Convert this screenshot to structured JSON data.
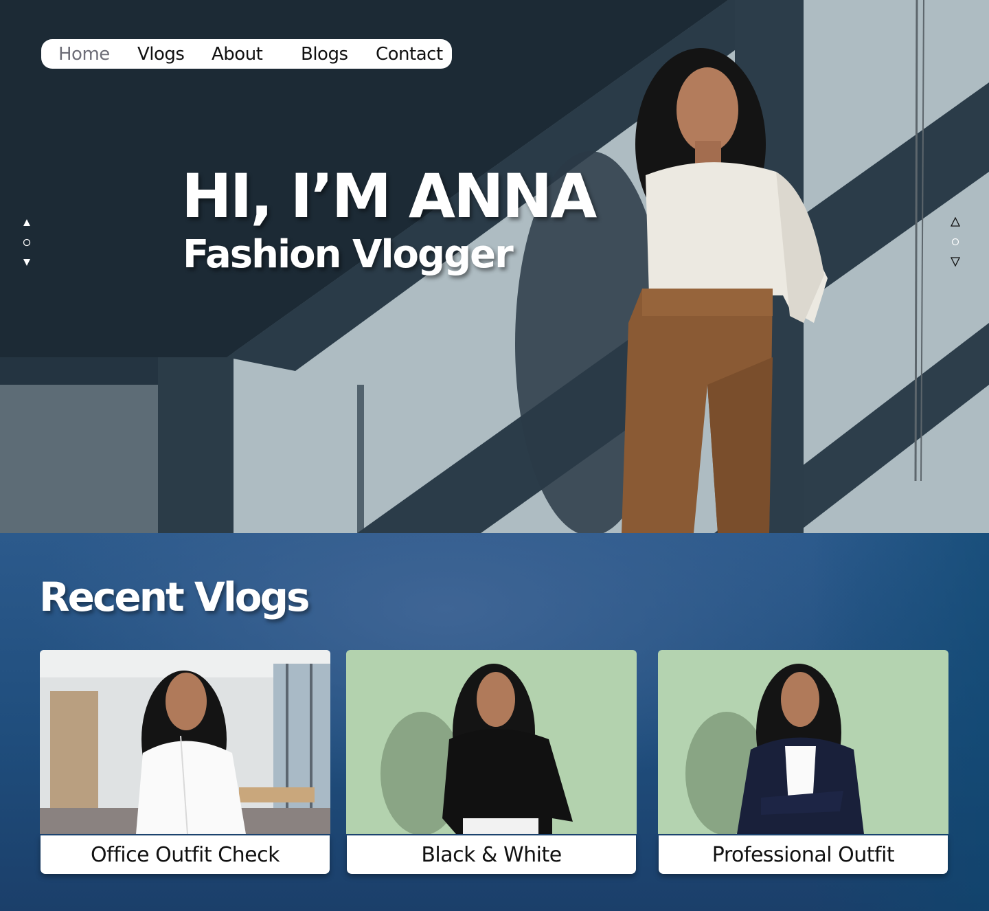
{
  "nav": {
    "items": [
      {
        "label": "Home",
        "active": true
      },
      {
        "label": "Vlogs",
        "active": false
      },
      {
        "label": "About",
        "active": false
      },
      {
        "label": "Blogs",
        "active": false
      },
      {
        "label": "Contact",
        "active": false
      }
    ]
  },
  "hero": {
    "title": "HI, I’M ANNA",
    "subtitle": "Fashion Vlogger"
  },
  "pager_left": {
    "up_icon": "filled-up-triangle-icon",
    "dot_icon": "circle-dot-icon",
    "down_icon": "filled-down-triangle-icon"
  },
  "pager_right": {
    "up_icon": "outline-up-triangle-icon",
    "dot_icon": "circle-dot-icon",
    "down_icon": "outline-down-triangle-icon"
  },
  "recent": {
    "title": "Recent Vlogs",
    "cards": [
      {
        "caption": "Office Outfit Check"
      },
      {
        "caption": "Black & White"
      },
      {
        "caption": "Professional Outfit"
      }
    ]
  },
  "colors": {
    "hero_dark": "#263644",
    "hero_light_wall": "#b9c4c9",
    "section_blue": "#2c5a8c",
    "nav_active": "#6e6e78",
    "trousers": "#8a5a34",
    "sweater": "#ece9e1",
    "card_green": "#b3d2ae"
  }
}
